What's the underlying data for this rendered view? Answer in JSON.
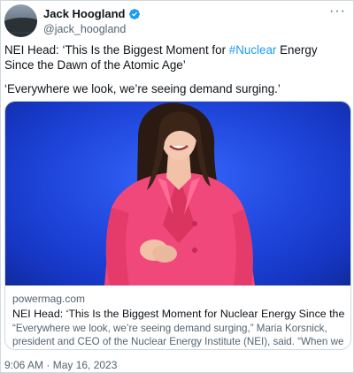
{
  "author": {
    "display_name": "Jack Hoogland",
    "handle": "@jack_hoogland",
    "verified_color": "#1d9bf0"
  },
  "tweet": {
    "text_before_hashtag": "NEI Head: ‘This Is the Biggest Moment for ",
    "hashtag": "#Nuclear",
    "text_after_hashtag": " Energy Since the Dawn of the Atomic Age’",
    "quote": "‘Everywhere we look, we’re seeing demand surging.’",
    "timestamp": "9:06 AM · May 16, 2023"
  },
  "link_card": {
    "domain": "powermag.com",
    "title": "NEI Head: ‘This Is the Biggest Moment for Nuclear Energy Since the Dawn of t...",
    "description": "“Everywhere we look, we’re seeing demand surging,” Maria Korsnick, president and CEO of the Nuclear Energy Institute (NEI), said. “When we talk about ..."
  },
  "icons": {
    "more": "more-options-icon",
    "verified": "verified-badge-icon"
  },
  "colors": {
    "link_blue": "#1d9bf0",
    "secondary_text": "#536471",
    "border": "#cfd9de",
    "stage_blue": "#1f49e6",
    "jacket_pink": "#f0487a"
  }
}
